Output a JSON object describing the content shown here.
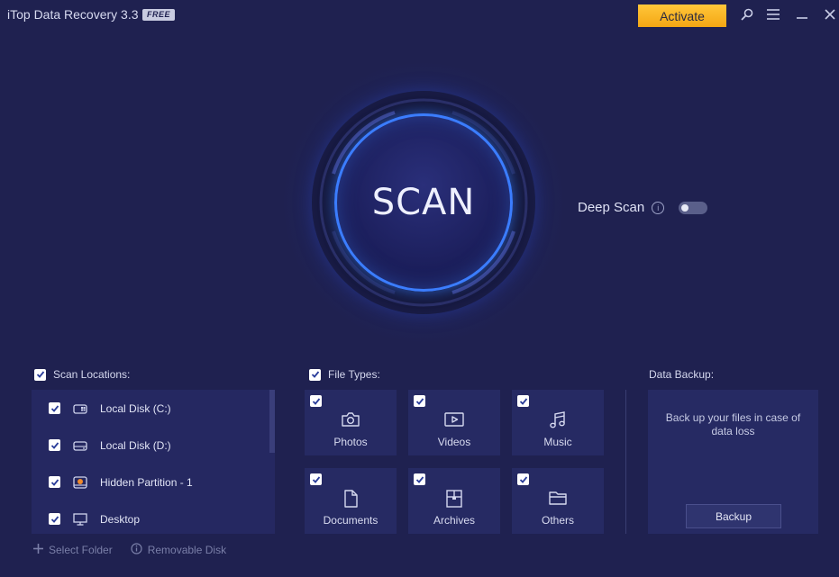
{
  "window": {
    "title": "iTop Data Recovery 3.3",
    "badge": "FREE",
    "activate_label": "Activate",
    "icons": [
      "search-icon",
      "menu-icon",
      "minimize-icon",
      "close-icon"
    ]
  },
  "scan": {
    "button_label": "SCAN",
    "deep_scan_label": "Deep Scan",
    "deep_scan_enabled": false
  },
  "scan_locations": {
    "header": "Scan Locations:",
    "checked": true,
    "items": [
      {
        "label": "Local Disk (C:)",
        "icon": "windows-drive-icon",
        "checked": true
      },
      {
        "label": "Local Disk (D:)",
        "icon": "drive-icon",
        "checked": true
      },
      {
        "label": "Hidden Partition - 1",
        "icon": "hidden-partition-icon",
        "checked": true
      },
      {
        "label": "Desktop",
        "icon": "desktop-icon",
        "checked": true
      }
    ],
    "select_folder": "Select Folder",
    "removable_disk": "Removable Disk"
  },
  "file_types": {
    "header": "File Types:",
    "checked": true,
    "items": [
      {
        "label": "Photos",
        "icon": "camera-icon",
        "checked": true
      },
      {
        "label": "Videos",
        "icon": "video-icon",
        "checked": true
      },
      {
        "label": "Music",
        "icon": "music-icon",
        "checked": true
      },
      {
        "label": "Documents",
        "icon": "document-icon",
        "checked": true
      },
      {
        "label": "Archives",
        "icon": "archive-icon",
        "checked": true
      },
      {
        "label": "Others",
        "icon": "folder-icon",
        "checked": true
      }
    ]
  },
  "data_backup": {
    "header": "Data Backup:",
    "description": "Back up your files in case of data loss",
    "button_label": "Backup"
  },
  "colors": {
    "background": "#1f2150",
    "panel": "#262a63",
    "accent_blue": "#3b7dff",
    "activate": "#f4a714"
  }
}
